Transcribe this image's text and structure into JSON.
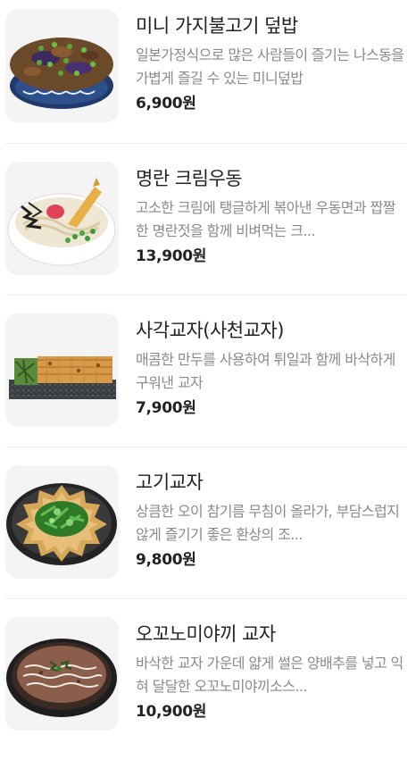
{
  "menu": {
    "items": [
      {
        "name": "미니 가지불고기 덮밥",
        "description": "일본가정식으로 많은 사람들이 즐기는 나스동을 가볍게 즐길 수 있는 미니덮밥",
        "price": "6,900원",
        "image_icon": "eggplant-bulgogi-bowl-icon"
      },
      {
        "name": "명란 크림우동",
        "description": "고소한 크림에 탱글하게 볶아낸 우동면과 짭짤한 명란젓을 함께 비벼먹는 크...",
        "price": "13,900원",
        "image_icon": "mentaiko-cream-udon-icon"
      },
      {
        "name": "사각교자(사천교자)",
        "description": "매콤한 만두를 사용하여 튀일과 함께 바삭하게 구워낸 교자",
        "price": "7,900원",
        "image_icon": "square-gyoza-icon"
      },
      {
        "name": "고기교자",
        "description": "상큼한 오이 참기름 무침이 올라가, 부담스럽지않게 즐기기 좋은 환상의 조...",
        "price": "9,800원",
        "image_icon": "meat-gyoza-icon"
      },
      {
        "name": "오꼬노미야끼 교자",
        "description": "바삭한 교자 가운데 얇게 썰은 양배추를 넣고 익혀 달달한 오꼬노미야끼소스...",
        "price": "10,900원",
        "image_icon": "okonomiyaki-gyoza-icon"
      }
    ]
  }
}
